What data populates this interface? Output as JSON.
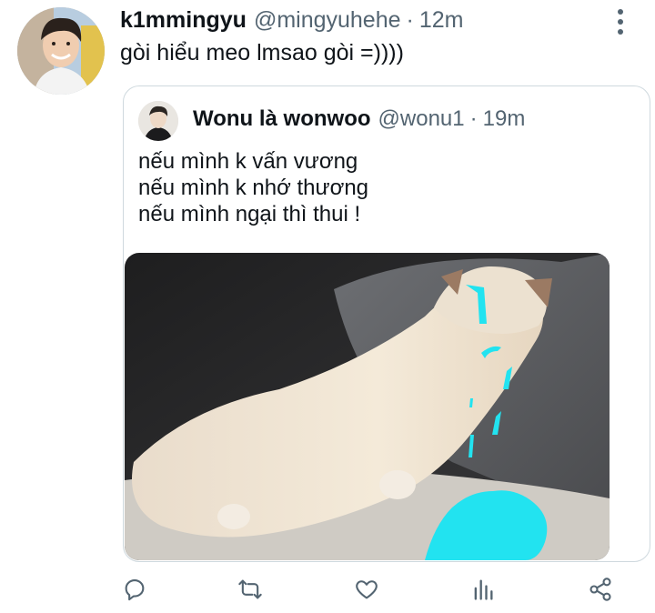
{
  "tweet": {
    "author_name": "k1mmingyu",
    "author_handle": "@mingyuhehe",
    "separator": "·",
    "time": "12m",
    "text": "gòi hiểu meo lmsao gòi =))))"
  },
  "quoted_tweet": {
    "author_name": "Wonu là wonwoo",
    "author_handle": "@wonu1",
    "separator": "·",
    "time": "19m",
    "lines": [
      "nếu mình k vấn vương",
      "nếu mình k nhớ thương",
      "nếu mình ngại thì thui !"
    ]
  },
  "icons": {
    "more": "more-vertical-icon",
    "reply": "reply-icon",
    "retweet": "retweet-icon",
    "like": "heart-icon",
    "analytics": "analytics-icon",
    "share": "share-icon"
  },
  "colors": {
    "text": "#0f1419",
    "secondary": "#536471",
    "border": "#cfd9de",
    "tears": "#22e3f0"
  }
}
